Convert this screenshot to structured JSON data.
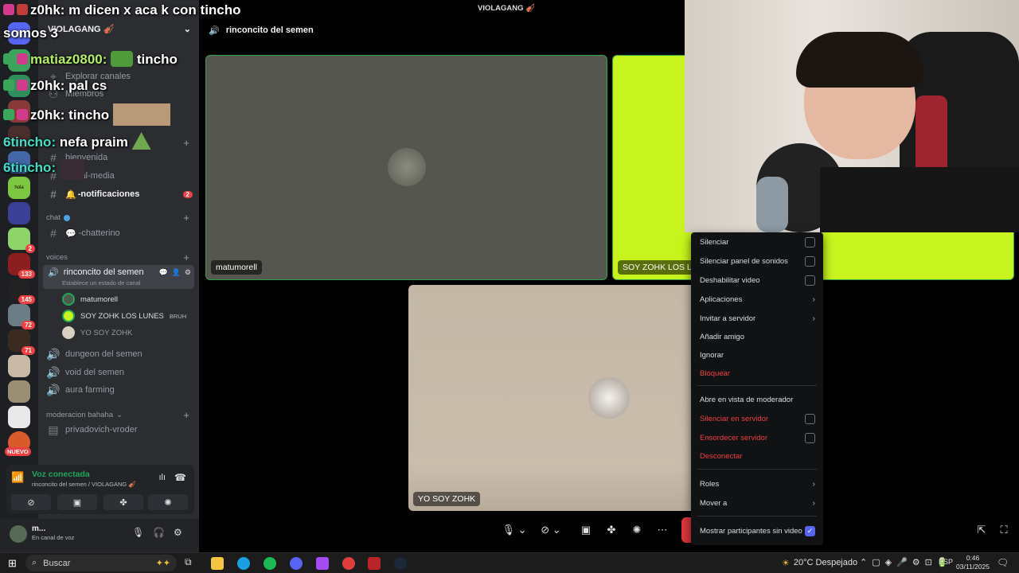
{
  "overlay": {
    "line1": "z0hk: m dicen x aca k con tincho",
    "line2": "somos 3",
    "line3_user": "matiaz0800:",
    "line3_msg": "tincho",
    "line4": "z0hk: pal cs",
    "line5": "z0hk: tincho",
    "line6_user": "6tincho:",
    "line6_msg": "nefa praim",
    "line7": "6tincho:"
  },
  "server": {
    "name": "VIOLAGANG 🎻",
    "window_title": "VIOLAGANG 🎻"
  },
  "sidebar": {
    "explore": "Explorar canales",
    "members": "Miembros",
    "channels_a": [
      "bienvenida",
      "social-media",
      "-notificaciones"
    ],
    "notif_badge": "2",
    "chat_category": "chat",
    "chat_channel": "-chatterino",
    "voices_category": "voices",
    "active_voice": "rinconcito del semen",
    "set_status": "Establece un estado de canal",
    "members_list": [
      {
        "name": "matumorell",
        "tag": ""
      },
      {
        "name": "SOY ZOHK LOS LUNES",
        "tag": "BRUH"
      },
      {
        "name": "YO SOY ZOHK",
        "tag": ""
      }
    ],
    "voice_channels": [
      "dungeon del semen",
      "void del semen",
      "aura farming"
    ],
    "mod_category": "moderacion bahaha",
    "mod_channel": "privadovich-vroder"
  },
  "rail_badges": [
    "2",
    "133",
    "145",
    "72",
    "71",
    "NUEVO"
  ],
  "voice_panel": {
    "status": "Voz conectada",
    "location": "rinconcito del semen / VIOLAGANG 🎻"
  },
  "user": {
    "name": "m...",
    "status": "En canal de voz"
  },
  "topbar": {
    "channel": "rinconcito del semen"
  },
  "tiles": [
    {
      "name": "matumorell"
    },
    {
      "name": "SOY ZOHK LOS LUNES"
    },
    {
      "name": "YO SOY ZOHK"
    }
  ],
  "context_menu": {
    "items": [
      "Silenciar",
      "Silenciar panel de sonidos",
      "Deshabilitar video",
      "Aplicaciones",
      "Invitar a servidor",
      "Añadir amigo",
      "Ignorar",
      "Bloquear",
      "Abre en vista de moderador",
      "Silenciar en servidor",
      "Ensordecer servidor",
      "Desconectar",
      "Roles",
      "Mover a",
      "Mostrar participantes sin video"
    ]
  },
  "taskbar": {
    "search": "Buscar",
    "weather": "20°C Despejado",
    "lang": "ESP",
    "time": "0:46",
    "date": "03/11/2025"
  },
  "colors": {
    "accent": "#5865f2",
    "danger": "#f23f43",
    "tile_green": "#c6f41c",
    "voice_green": "#23a55a"
  }
}
